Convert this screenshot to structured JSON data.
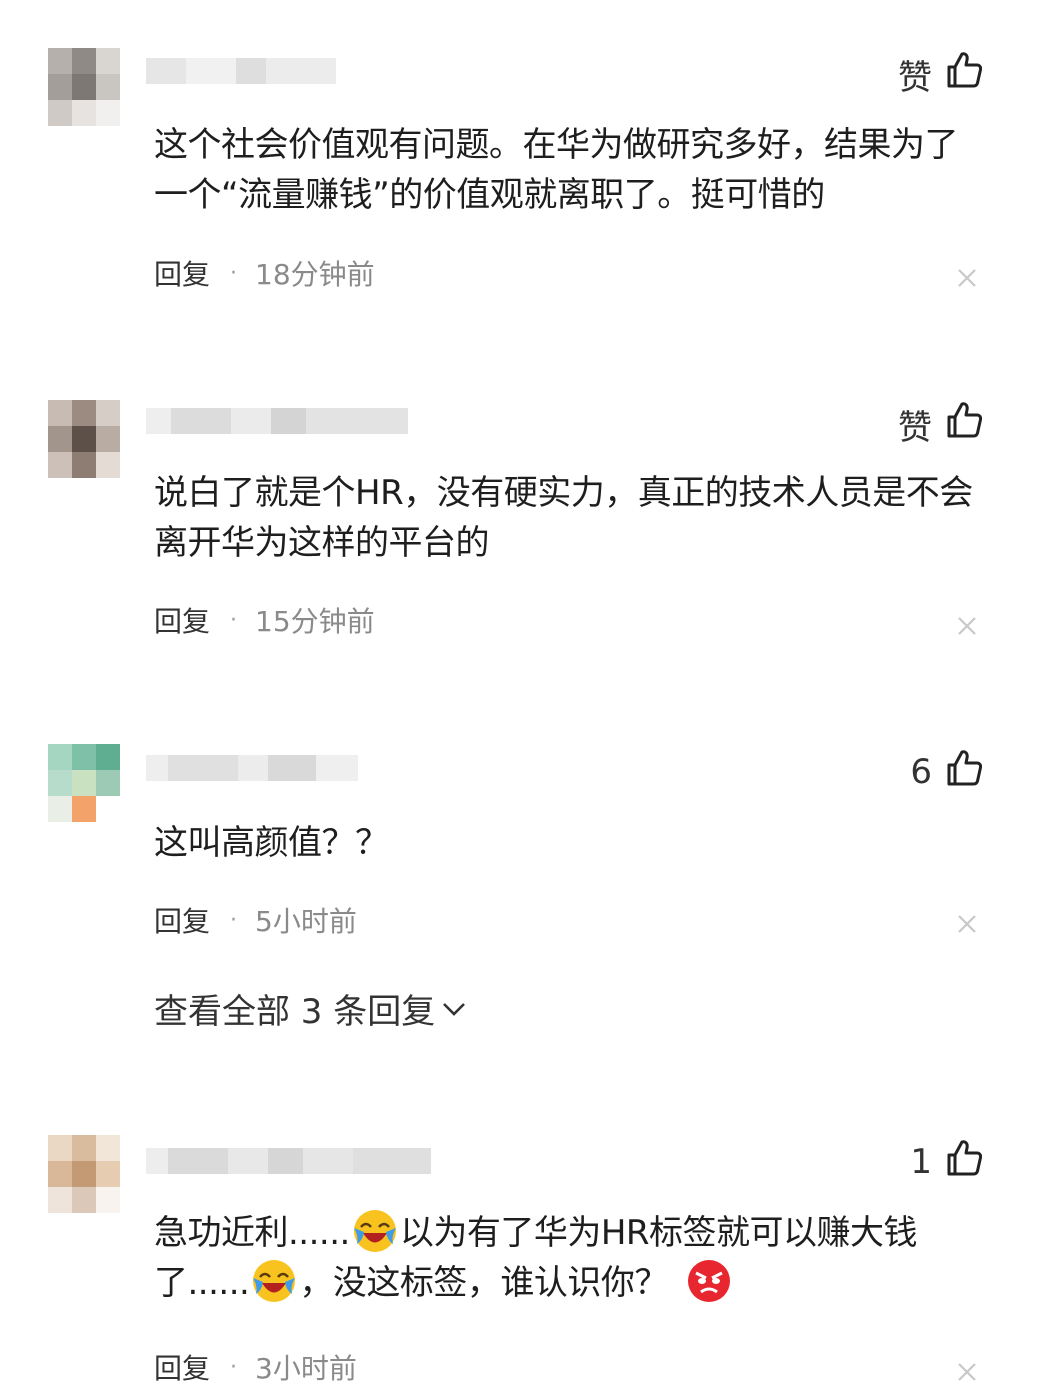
{
  "comments": [
    {
      "like_label": "赞",
      "text": "这个社会价值观有问题。在华为做研究多好，结果为了一个“流量赚钱”的价值观就离职了。挺可惜的",
      "reply_label": "回复",
      "time": "18分钟前"
    },
    {
      "like_label": "赞",
      "text": "说白了就是个HR，没有硬实力，真正的技术人员是不会离开华为这样的平台的",
      "reply_label": "回复",
      "time": "15分钟前"
    },
    {
      "like_label": "6",
      "text": "这叫高颜值？？",
      "reply_label": "回复",
      "time": "5小时前"
    },
    {
      "like_label": "1",
      "text_parts": [
        "急功近利......",
        "以为有了华为HR标签就可以赚大钱了......",
        "，没这标签，谁认识你？"
      ],
      "emojis": [
        "laughing-crying-emoji",
        "laughing-crying-emoji",
        "angry-emoji"
      ],
      "reply_label": "回复",
      "time": "3小时前"
    }
  ],
  "view_all_replies": "查看全部 3 条回复",
  "icons": [
    "thumbs-up-icon",
    "close-icon",
    "chevron-down-icon"
  ],
  "colors": {
    "text": "#1e1e1e",
    "meta": "#8a8a8a",
    "close": "#c8c8c8"
  }
}
